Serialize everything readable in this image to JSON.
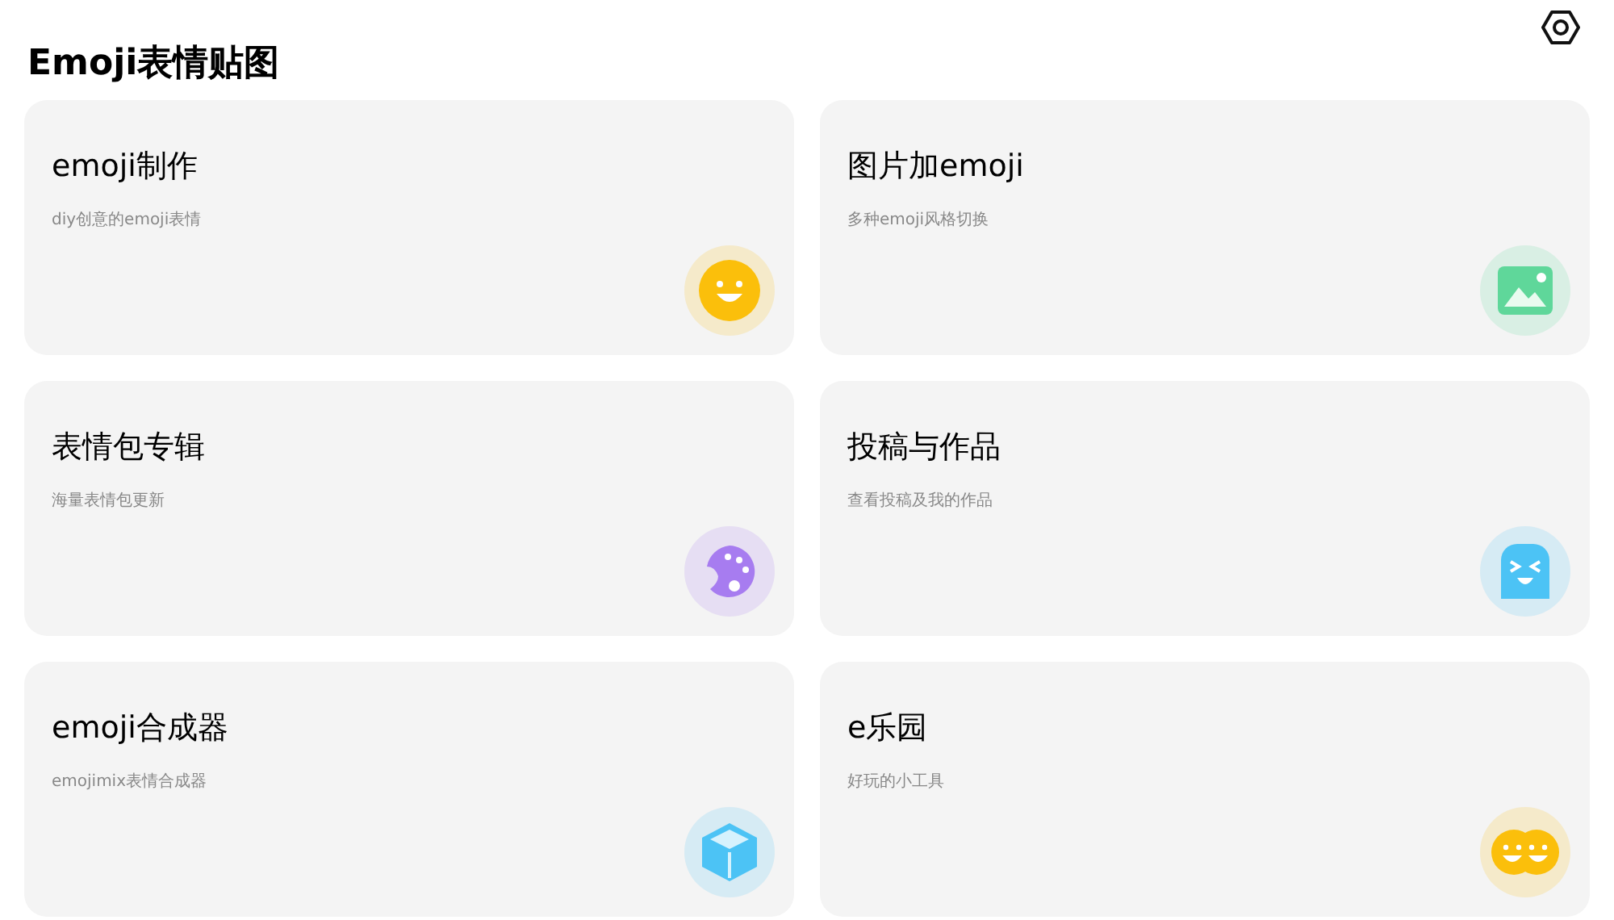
{
  "title": "Emoji表情贴图",
  "cards": [
    {
      "title": "emoji制作",
      "subtitle": "diy创意的emoji表情",
      "kind": "smiley",
      "color": "#fbbf0b"
    },
    {
      "title": "图片加emoji",
      "subtitle": "多种emoji风格切换",
      "kind": "image",
      "color": "#5fd79a"
    },
    {
      "title": "表情包专辑",
      "subtitle": "海量表情包更新",
      "kind": "palette",
      "color": "#a77cf0"
    },
    {
      "title": "投稿与作品",
      "subtitle": "查看投稿及我的作品",
      "kind": "ghost",
      "color": "#4cc3f5"
    },
    {
      "title": "emoji合成器",
      "subtitle": "emojimix表情合成器",
      "kind": "cube",
      "color": "#4cc3f5"
    },
    {
      "title": "e乐园",
      "subtitle": "好玩的小工具",
      "kind": "twins",
      "color": "#fbbf0b"
    }
  ]
}
